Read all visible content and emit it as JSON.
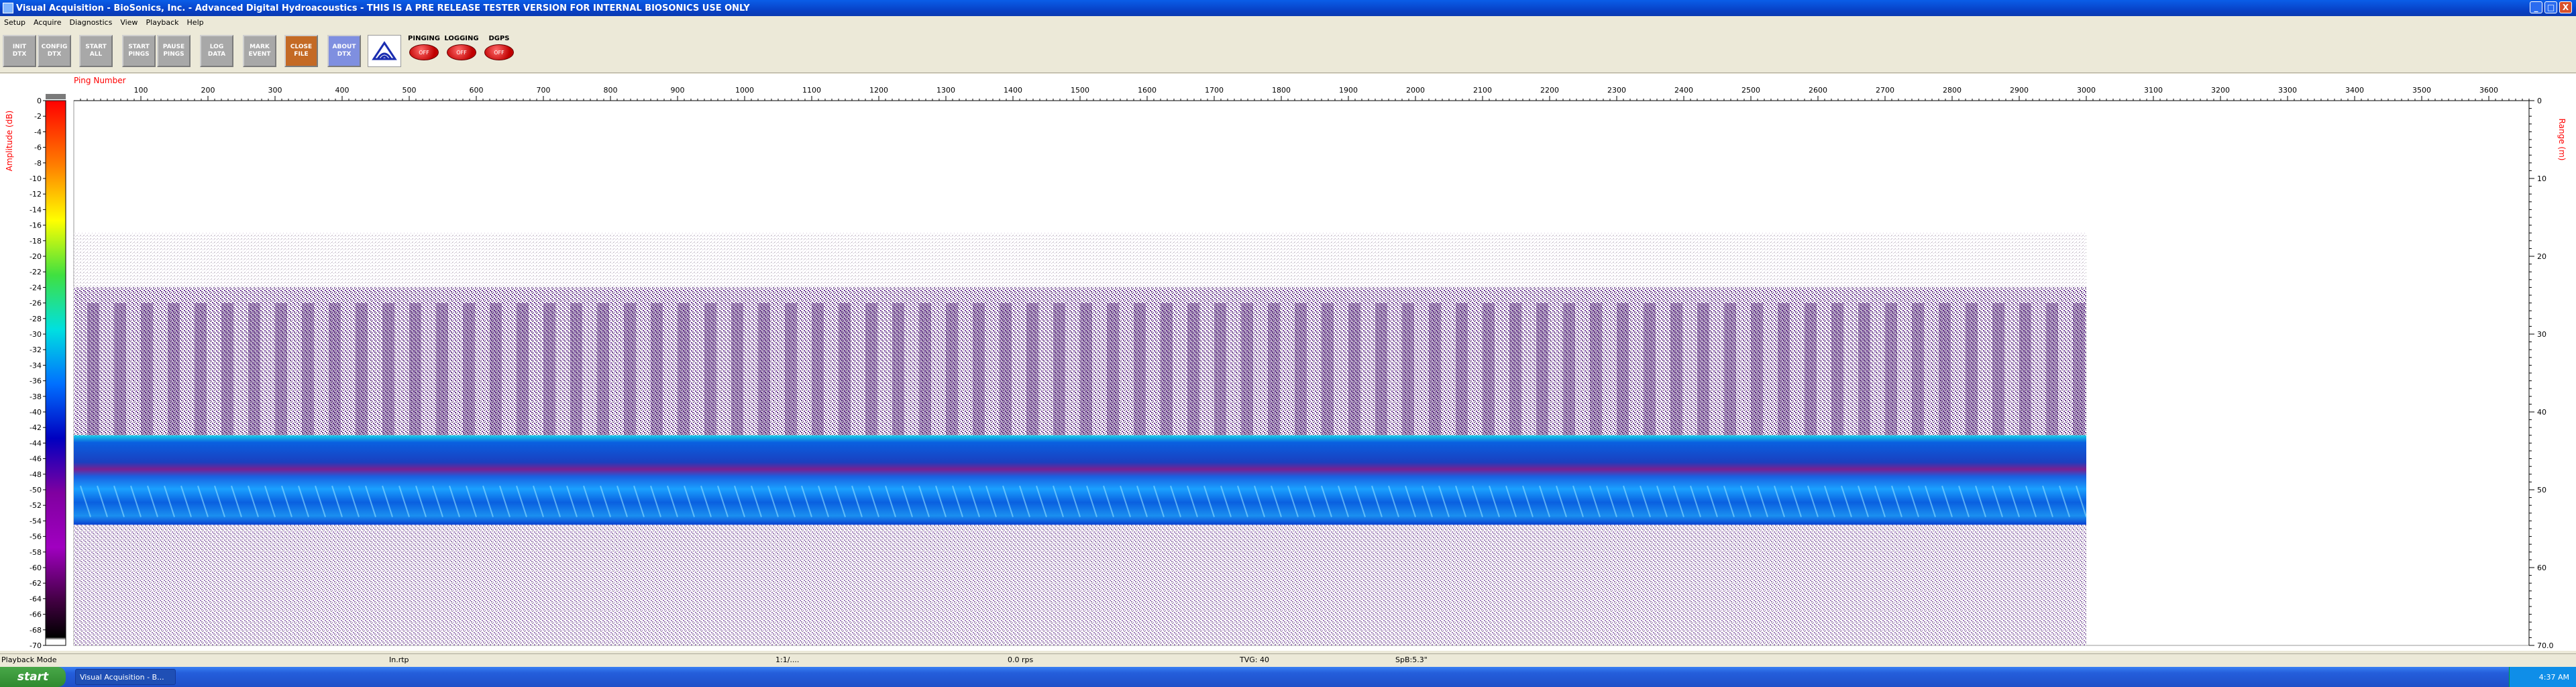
{
  "window": {
    "title": "Visual Acquisition  -  BioSonics, Inc.  -  Advanced Digital Hydroacoustics  -  THIS IS A PRE RELEASE TESTER VERSION FOR INTERNAL BIOSONICS USE ONLY",
    "minimize": "_",
    "maximize": "□",
    "close": "X"
  },
  "menu": [
    "Setup",
    "Acquire",
    "Diagnostics",
    "View",
    "Playback",
    "Help"
  ],
  "toolbar": {
    "buttons": [
      "INIT\nDTX",
      "CONFIG\nDTX",
      "START\nALL",
      "START\nPINGS",
      "PAUSE\nPINGS",
      "LOG\nDATA",
      "MARK\nEVENT",
      "CLOSE\nFILE",
      "ABOUT\nDTX"
    ],
    "status": [
      {
        "label": "PINGING",
        "state": "OFF"
      },
      {
        "label": "LOGGING",
        "state": "OFF"
      },
      {
        "label": "DGPS",
        "state": "OFF"
      }
    ]
  },
  "colors": {
    "window_bg": "#ece9d8",
    "titlebar": "#0a4fd8",
    "axis_label": "#ff0000",
    "echo_purple": "#5a1a8a",
    "echo_blue": "#1a7fe0"
  },
  "chart_data": {
    "type": "heatmap",
    "title": "",
    "x_axis_label": "Ping Number",
    "y_left_label": "Amplitude (dB)",
    "y_right_label": "Range (m)",
    "x_ticks": [
      100,
      200,
      300,
      400,
      500,
      600,
      700,
      800,
      900,
      1000,
      1100,
      1200,
      1300,
      1400,
      1500,
      1600,
      1700,
      1800,
      1900,
      2000,
      2100,
      2200,
      2300,
      2400,
      2500,
      2600,
      2700,
      2800,
      2900,
      3000,
      3100,
      3200,
      3300,
      3400,
      3500,
      3600
    ],
    "x_range": [
      0,
      3660
    ],
    "data_end_ping": 3000,
    "range_ticks": [
      "0",
      "10",
      "20",
      "30",
      "40",
      "50",
      "60",
      "70.0"
    ],
    "range_limits": [
      0,
      70
    ],
    "amplitude_ticks": [
      "0",
      "-2",
      "-4",
      "-6",
      "-8",
      "-10",
      "-12",
      "-14",
      "-16",
      "-18",
      "-20",
      "-22",
      "-24",
      "-26",
      "-28",
      "-30",
      "-32",
      "-34",
      "-36",
      "-38",
      "-40",
      "-42",
      "-44",
      "-46",
      "-48",
      "-50",
      "-52",
      "-54",
      "-56",
      "-58",
      "-60",
      "-62",
      "-64",
      "-66",
      "-68",
      "-70"
    ],
    "amplitude_range": [
      0,
      -70
    ],
    "features": {
      "surface_noise_m": [
        17,
        24
      ],
      "water_column_m": [
        24,
        43
      ],
      "bottom_band_m": [
        43,
        54.5
      ],
      "sub_bottom_m": [
        54.5,
        70
      ]
    },
    "colorbar": [
      "#ffffff",
      "#ff0000",
      "#ff8000",
      "#ffff00",
      "#80ff00",
      "#00c000",
      "#00e0e0",
      "#0080ff",
      "#0000c0",
      "#6000a0",
      "#800080",
      "#400040",
      "#000000"
    ]
  },
  "status_bar": [
    "Playback Mode",
    "In.rtp",
    "1:1/....",
    "0.0 rps",
    "TVG: 40",
    "SpB:5.3\""
  ],
  "taskbar": {
    "start": "start",
    "task": "Visual Acquisition - B...",
    "clock": "4:37 AM"
  }
}
